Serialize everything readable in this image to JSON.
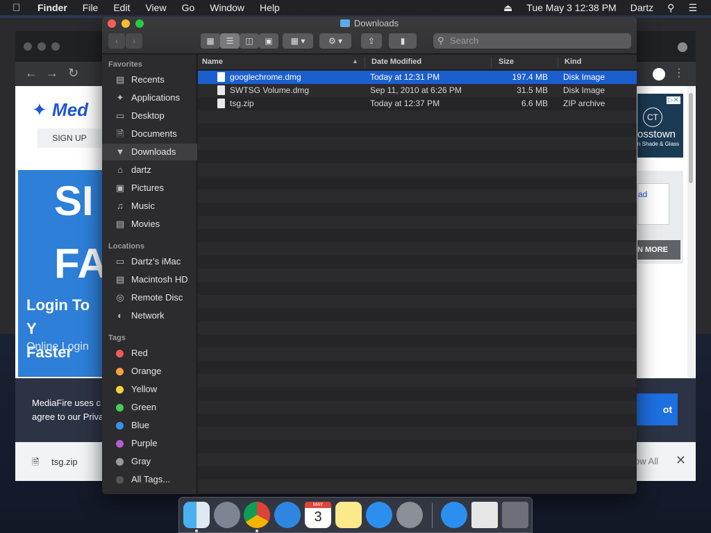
{
  "menubar": {
    "apple": "",
    "items": [
      "Finder",
      "File",
      "Edit",
      "View",
      "Go",
      "Window",
      "Help"
    ],
    "clock": "Tue May 3  12:38 PM",
    "user": "Dartz"
  },
  "chrome": {
    "logo_text": "Med",
    "signup": "SIGN UP",
    "hero_big1": "SI",
    "hero_big2": "FA",
    "hero_login": "Login To Y",
    "hero_faster": "Faster",
    "hero_online": "Online Login",
    "cookie_line1": "MediaFire uses c",
    "cookie_line2": "agree to our Priva",
    "cookie_button": "ot",
    "download_file": "tsg.zip",
    "show_all": "ow All",
    "ad_text": "osstown",
    "ad_sub": "n Shade & Glass",
    "card_link": "ad",
    "card_more": "N MORE"
  },
  "finder": {
    "title": "Downloads",
    "search_placeholder": "Search",
    "sidebar": {
      "favorites_label": "Favorites",
      "favorites": [
        "Recents",
        "Applications",
        "Desktop",
        "Documents",
        "Downloads",
        "dartz",
        "Pictures",
        "Music",
        "Movies"
      ],
      "locations_label": "Locations",
      "locations": [
        "Dartz’s iMac",
        "Macintosh HD",
        "Remote Disc",
        "Network"
      ],
      "tags_label": "Tags",
      "tags": [
        "Red",
        "Orange",
        "Yellow",
        "Green",
        "Blue",
        "Purple",
        "Gray",
        "All Tags..."
      ],
      "tag_colors": [
        "#ef5b5b",
        "#f5a13c",
        "#f3d33b",
        "#4cc95b",
        "#3b8ff0",
        "#b65bd6",
        "#9a9a9a",
        "#555555"
      ]
    },
    "columns": {
      "name": "Name",
      "date": "Date Modified",
      "size": "Size",
      "kind": "Kind"
    },
    "files": [
      {
        "name": "googlechrome.dmg",
        "date": "Today at 12:31 PM",
        "size": "197.4 MB",
        "kind": "Disk Image"
      },
      {
        "name": "SWTSG Volume.dmg",
        "date": "Sep 11, 2010 at 6:26 PM",
        "size": "31.5 MB",
        "kind": "Disk Image"
      },
      {
        "name": "tsg.zip",
        "date": "Today at 12:37 PM",
        "size": "6.6 MB",
        "kind": "ZIP archive"
      }
    ]
  },
  "dock": {
    "calendar_month": "MAY",
    "calendar_day": "3"
  }
}
